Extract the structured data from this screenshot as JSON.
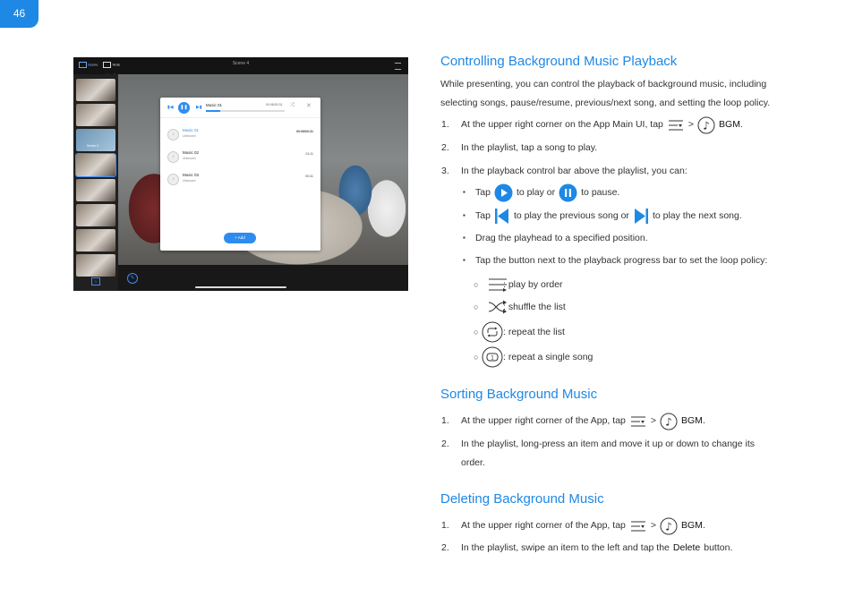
{
  "page": {
    "number": "46"
  },
  "screenshot": {
    "scene_title": "Scene 4",
    "scene_sub": "New Business",
    "tab_scene": "Scene",
    "tab_note": "Note",
    "thumb_label": "Scene 3",
    "page_indicator": "1",
    "player": {
      "title": "Music 01",
      "time": "00:06/00:31",
      "progress": 0.18,
      "add_label": "+ Add",
      "songs": [
        {
          "name": "Music 01",
          "artist": "Unknown",
          "time": "00:06/00:31",
          "active": true
        },
        {
          "name": "Music 02",
          "artist": "Unknown",
          "time": "01:11",
          "active": false
        },
        {
          "name": "Music 03",
          "artist": "Unknown",
          "time": "00:41",
          "active": false
        }
      ]
    }
  },
  "sections": {
    "control": {
      "heading": "Controlling Background Music Playback",
      "intro": "While presenting, you can control the playback of background music, including selecting songs, pause/resume, previous/next song, and setting the loop policy.",
      "step1_num": "1.",
      "step1_text": "At the upper right corner on the App Main UI, tap",
      "gt": ">",
      "bgm": "BGM",
      "period": ".",
      "step2_num": "2.",
      "step2_text": "In the playlist, tap a song to play.",
      "step3_num": "3.",
      "step3_text": "In the playback control bar above the playlist, you can:",
      "b1_tap": "Tap",
      "b1_mid": "to play or",
      "b1_end": "to pause.",
      "b2_tap": "Tap",
      "b2_mid": "to play the previous song or",
      "b2_end": "to play the next song.",
      "b3": "Drag the playhead to a specified position.",
      "b4": "Tap the button next to the playback progress bar to set the loop policy:",
      "loop1": ": play by order",
      "loop2": ": shuffle the list",
      "loop3": ": repeat the list",
      "loop4": ": repeat a single song"
    },
    "sorting": {
      "heading": "Sorting Background Music",
      "step1_num": "1.",
      "step1_text": "At the upper right corner of the App, tap",
      "step2_num": "2.",
      "step2_text": "In the playlist, long-press an item and move it up or down to change its order."
    },
    "deleting": {
      "heading": "Deleting Background Music",
      "step1_num": "1.",
      "step1_text": "At the upper right corner of the App, tap",
      "step2_num": "2.",
      "step2_pre": "In the playlist, swipe an item to the left and tap the",
      "step2_bold": "Delete",
      "step2_post": "button."
    }
  }
}
